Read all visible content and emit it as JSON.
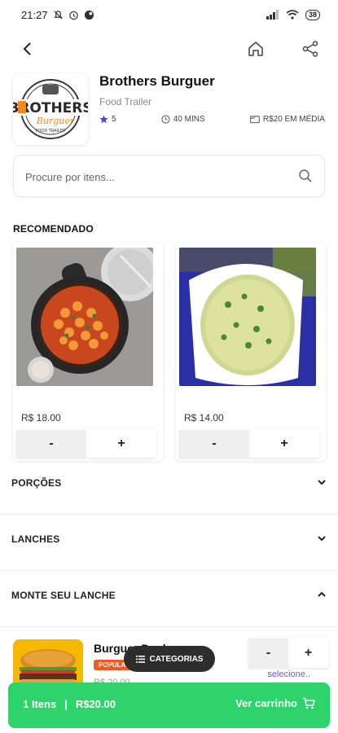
{
  "status_bar": {
    "time": "21:27",
    "battery": "38"
  },
  "store": {
    "logo_text": "BROTHERS",
    "logo_script": "Burguer",
    "logo_sub": "FOOD TRAILER",
    "name": "Brothers Burguer",
    "type": "Food Trailer",
    "rating": "5",
    "time": "40 MINS",
    "avg_price": "R$20 EM MÉDIA"
  },
  "search": {
    "placeholder": "Procure por itens..."
  },
  "recommended": {
    "title": "RECOMENDADO",
    "items": [
      {
        "price": "R$ 18.00",
        "minus": "-",
        "plus": "+"
      },
      {
        "price": "R$ 14.00",
        "minus": "-",
        "plus": "+"
      }
    ]
  },
  "categories": [
    {
      "label": "PORÇÕES",
      "expanded": false
    },
    {
      "label": "LANCHES",
      "expanded": false
    },
    {
      "label": "MONTE SEU LANCHE",
      "expanded": true
    }
  ],
  "product": {
    "name": "Burguer Dual ",
    "badge": "POPULAR",
    "price": "R$ 20.00",
    "minus": "-",
    "plus": "+",
    "select_label": "selecione.."
  },
  "categories_button": {
    "label": "CATEGORIAS"
  },
  "cart": {
    "items": "1 Itens",
    "separator": "|",
    "total": "R$20.00",
    "action": "Ver carrinho"
  },
  "colors": {
    "accent": "#2fd36c",
    "badge": "#f15a22",
    "select": "#7c4dff",
    "star": "#5b3cc4"
  }
}
